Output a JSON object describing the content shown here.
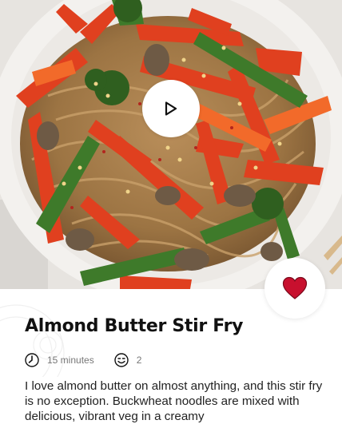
{
  "recipe": {
    "title": "Almond Butter Stir Fry",
    "time": "15 minutes",
    "servings": "2",
    "description": "I love almond butter on almost anything, and this stir fry is no exception. Buckwheat noodles are mixed with delicious, vibrant veg in a creamy"
  },
  "icons": {
    "play": "play-icon",
    "favorite": "heart-icon",
    "time": "clock-icon",
    "servings": "smiley-icon"
  },
  "colors": {
    "heart": "#c8102e",
    "meta_text": "#777777"
  }
}
